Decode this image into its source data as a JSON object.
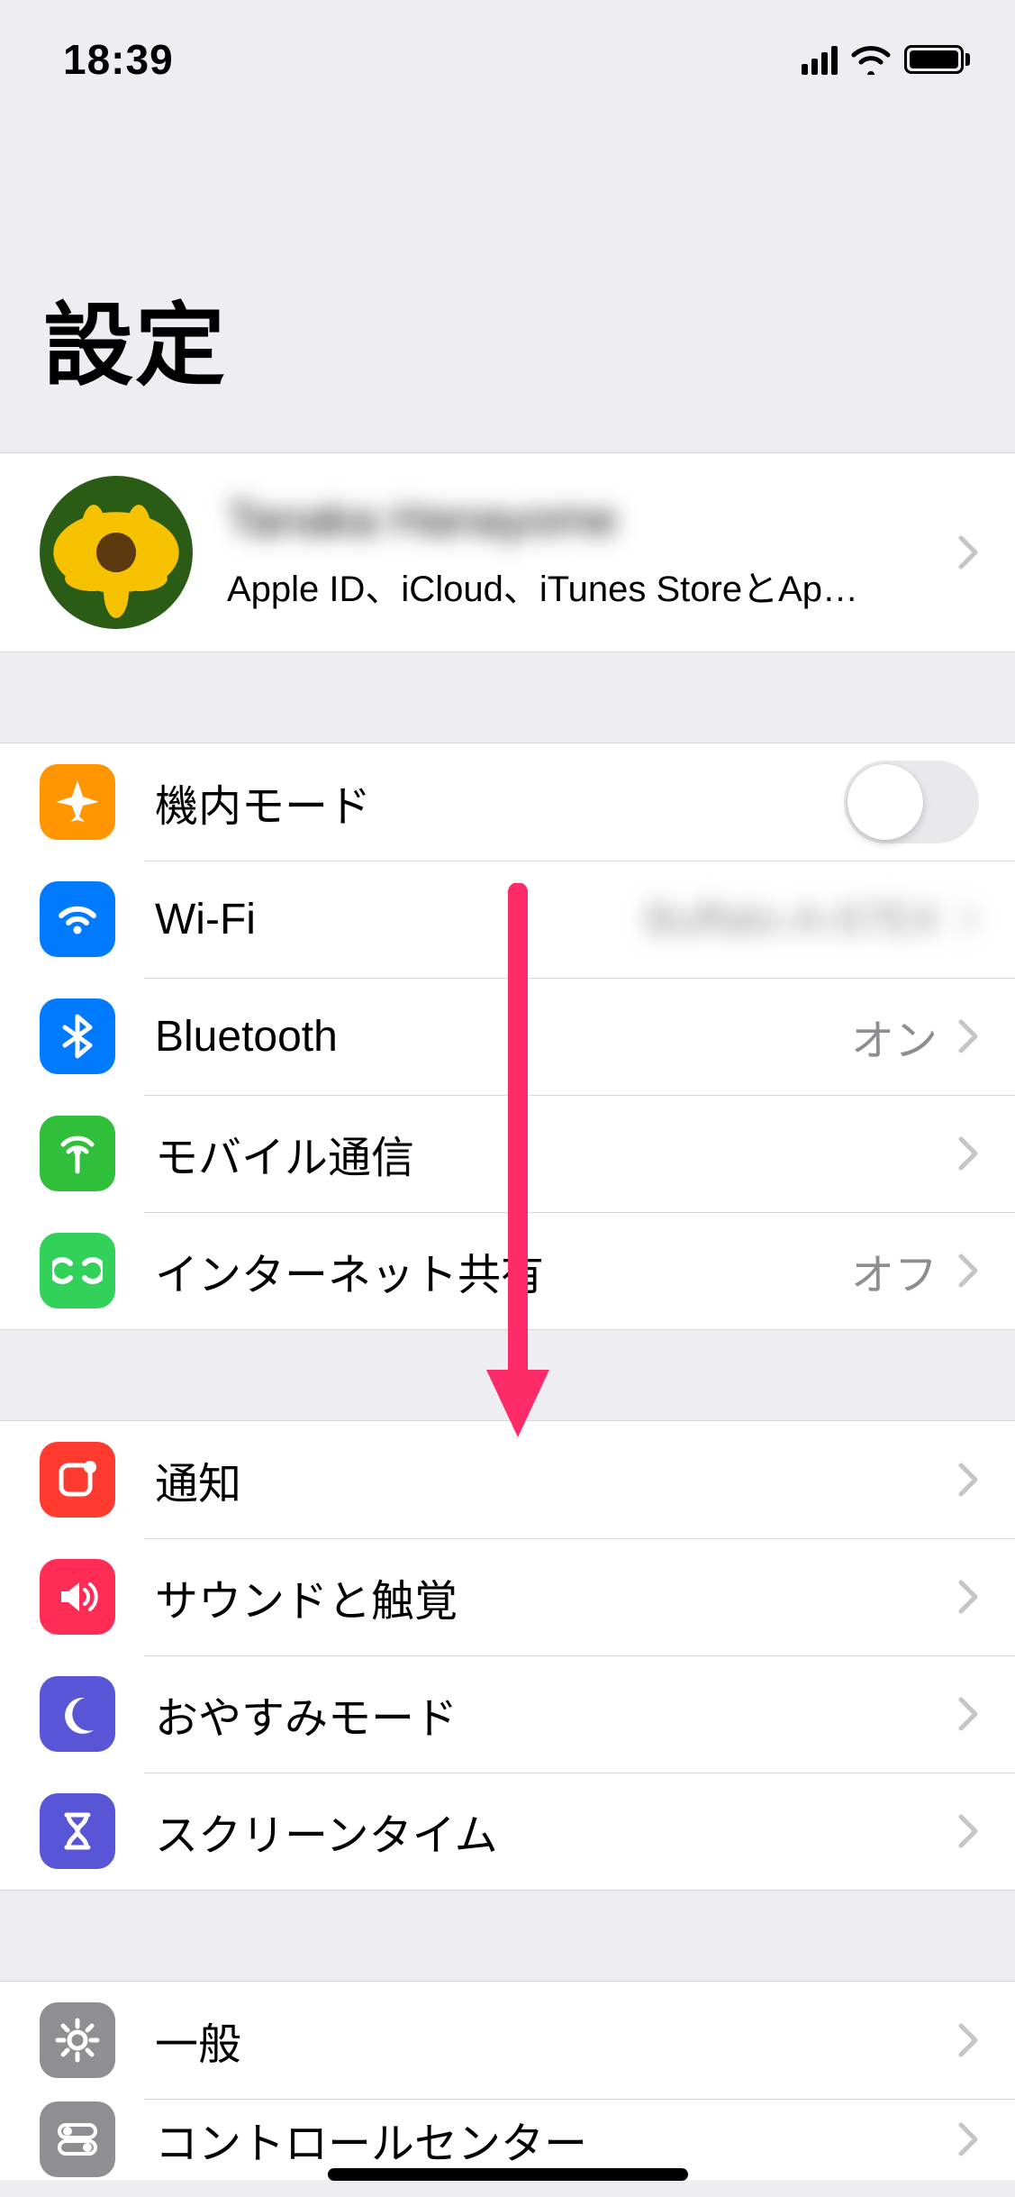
{
  "statusBar": {
    "time": "18:39"
  },
  "pageTitle": "設定",
  "appleId": {
    "name": "Tanaka Hanayome",
    "subtitle": "Apple ID、iCloud、iTunes StoreとApp S…"
  },
  "group1": {
    "airplane": {
      "label": "機内モード",
      "on": false
    },
    "wifi": {
      "label": "Wi-Fi",
      "value": "Buffalo-A-67E4"
    },
    "bluetooth": {
      "label": "Bluetooth",
      "value": "オン"
    },
    "cellular": {
      "label": "モバイル通信"
    },
    "hotspot": {
      "label": "インターネット共有",
      "value": "オフ"
    }
  },
  "group2": {
    "notifications": {
      "label": "通知"
    },
    "sounds": {
      "label": "サウンドと触覚"
    },
    "dnd": {
      "label": "おやすみモード"
    },
    "screentime": {
      "label": "スクリーンタイム"
    }
  },
  "group3": {
    "general": {
      "label": "一般"
    },
    "controlcenter": {
      "label": "コントロールセンター"
    }
  }
}
